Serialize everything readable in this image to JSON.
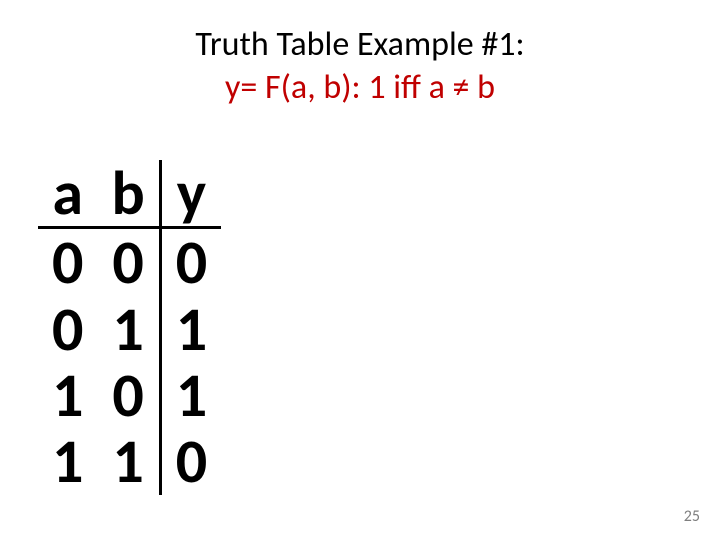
{
  "title": {
    "line1": "Truth Table Example #1:",
    "line2": "y= F(a, b): 1 iff a ≠ b"
  },
  "table": {
    "headers": {
      "a": "a",
      "b": "b",
      "y": "y"
    },
    "rows": [
      {
        "a": "0",
        "b": "0",
        "y": "0"
      },
      {
        "a": "0",
        "b": "1",
        "y": "1"
      },
      {
        "a": "1",
        "b": "0",
        "y": "1"
      },
      {
        "a": "1",
        "b": "1",
        "y": "0"
      }
    ]
  },
  "page_number": "25"
}
